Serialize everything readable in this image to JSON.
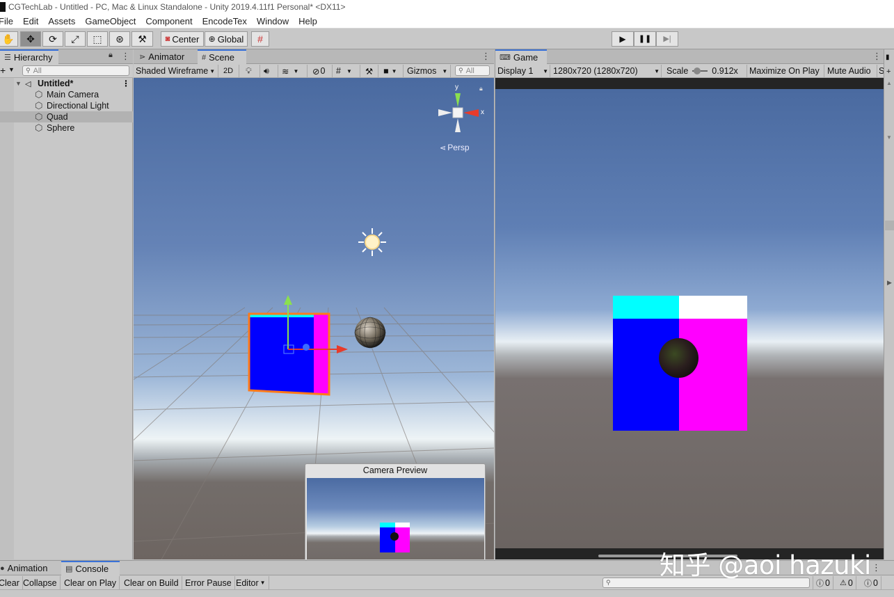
{
  "window": {
    "title": "CGTechLab - Untitled - PC, Mac & Linux Standalone - Unity 2019.4.11f1 Personal* <DX11>"
  },
  "menu": [
    "File",
    "Edit",
    "Assets",
    "GameObject",
    "Component",
    "EncodeTex",
    "Window",
    "Help"
  ],
  "toolbar": {
    "pivot_label": "Center",
    "space_label": "Global"
  },
  "hierarchy": {
    "tab_label": "Hierarchy",
    "search_placeholder": "All",
    "scene_name": "Untitled*",
    "objects": [
      "Main Camera",
      "Directional Light",
      "Quad",
      "Sphere"
    ],
    "selected": "Quad"
  },
  "scene": {
    "tabs": [
      "Animator",
      "Scene"
    ],
    "draw_mode": "Shaded Wireframe",
    "mode_2d": "2D",
    "hidden_count": "0",
    "gizmos_label": "Gizmos",
    "search_placeholder": "All",
    "projection_label": "Persp",
    "gizmo_axis_x": "x",
    "gizmo_axis_y": "y",
    "camera_preview_title": "Camera Preview"
  },
  "game": {
    "tab_label": "Game",
    "display": "Display 1",
    "resolution": "1280x720 (1280x720)",
    "scale_label": "Scale",
    "scale_value": "0.912x",
    "maximize_label": "Maximize On Play",
    "mute_label": "Mute Audio",
    "truncated_label": "S"
  },
  "console": {
    "tabs": [
      "Animation",
      "Console"
    ],
    "buttons": {
      "clear": "Clear",
      "collapse": "Collapse",
      "clear_on_play": "Clear on Play",
      "clear_on_build": "Clear on Build",
      "error_pause": "Error Pause",
      "editor": "Editor"
    },
    "counts": {
      "log": "0",
      "warning": "0",
      "error": "0"
    }
  },
  "watermark": "知乎 @aoi hazuki",
  "colors": {
    "quad_top_left": "#00ffff",
    "quad_top_right": "#ffffff",
    "quad_bottom_left": "#0000ff",
    "quad_bottom_right": "#ff00ff",
    "selection_outline": "#ff7a1a",
    "tab_accent": "#3a72d8"
  }
}
